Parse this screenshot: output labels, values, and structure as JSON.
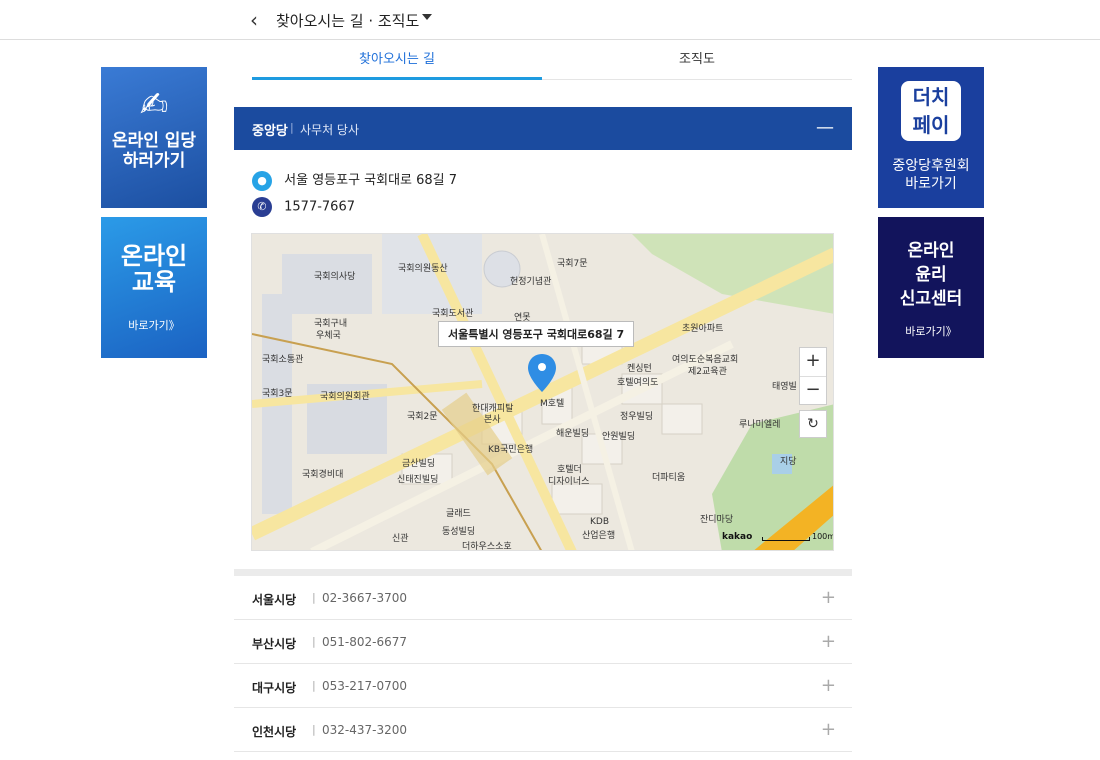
{
  "header": {
    "back_icon": "‹",
    "title": "찾아오시는 길 · 조직도"
  },
  "tabs": [
    {
      "label": "찾아오시는 길",
      "active": true
    },
    {
      "label": "조직도",
      "active": false
    }
  ],
  "banners": {
    "left_top": {
      "line1": "온라인 입당",
      "line2": "하러가기"
    },
    "left_bottom": {
      "line1": "온라인",
      "line2": "교육",
      "link": "바로가기》"
    },
    "right_top": {
      "logo1": "더치",
      "logo2": "페이",
      "line1": "중앙당후원회",
      "line2": "바로가기"
    },
    "right_bottom": {
      "line1": "온라인",
      "line2": "윤리",
      "line3": "신고센터",
      "link": "바로가기》"
    }
  },
  "office": {
    "name": "중앙당",
    "separator": "|",
    "subtitle": "사무처 당사",
    "address": "서울 영등포구 국회대로 68길 7",
    "phone": "1577-7667"
  },
  "map": {
    "tooltip": "서울특별시 영등포구 국회대로68길 7",
    "brand": "kakao",
    "scale": "100m",
    "labels": [
      "국회의사당",
      "국회의원동산",
      "국회7문",
      "헌정기념관",
      "국회도서관",
      "국회구내",
      "우체국",
      "연못",
      "초원아파트",
      "국회소통관",
      "국회3문",
      "국회의원회관",
      "국회2문",
      "켄싱턴",
      "호텔여의도",
      "여의도순복음교회",
      "제2교육관",
      "M호텔",
      "정우빌딩",
      "해운빌딩",
      "안원빌딩",
      "KB국민은행",
      "루나미엘레",
      "금산빌딩",
      "신태진빌딩",
      "국회경비대",
      "호텔더",
      "디자이너스",
      "더파티움",
      "글래드",
      "동성빌딩",
      "KDB",
      "산업은행",
      "잔디마당",
      "더하우스소호",
      "한대캐피탈",
      "본사",
      "신관",
      "태영빌",
      "지당"
    ]
  },
  "branches": [
    {
      "name": "서울시당",
      "phone": "02-3667-3700"
    },
    {
      "name": "부산시당",
      "phone": "051-802-6677"
    },
    {
      "name": "대구시당",
      "phone": "053-217-0700"
    },
    {
      "name": "인천시당",
      "phone": "032-437-3200"
    }
  ],
  "icons": {
    "collapse": "—",
    "expand": "+"
  }
}
